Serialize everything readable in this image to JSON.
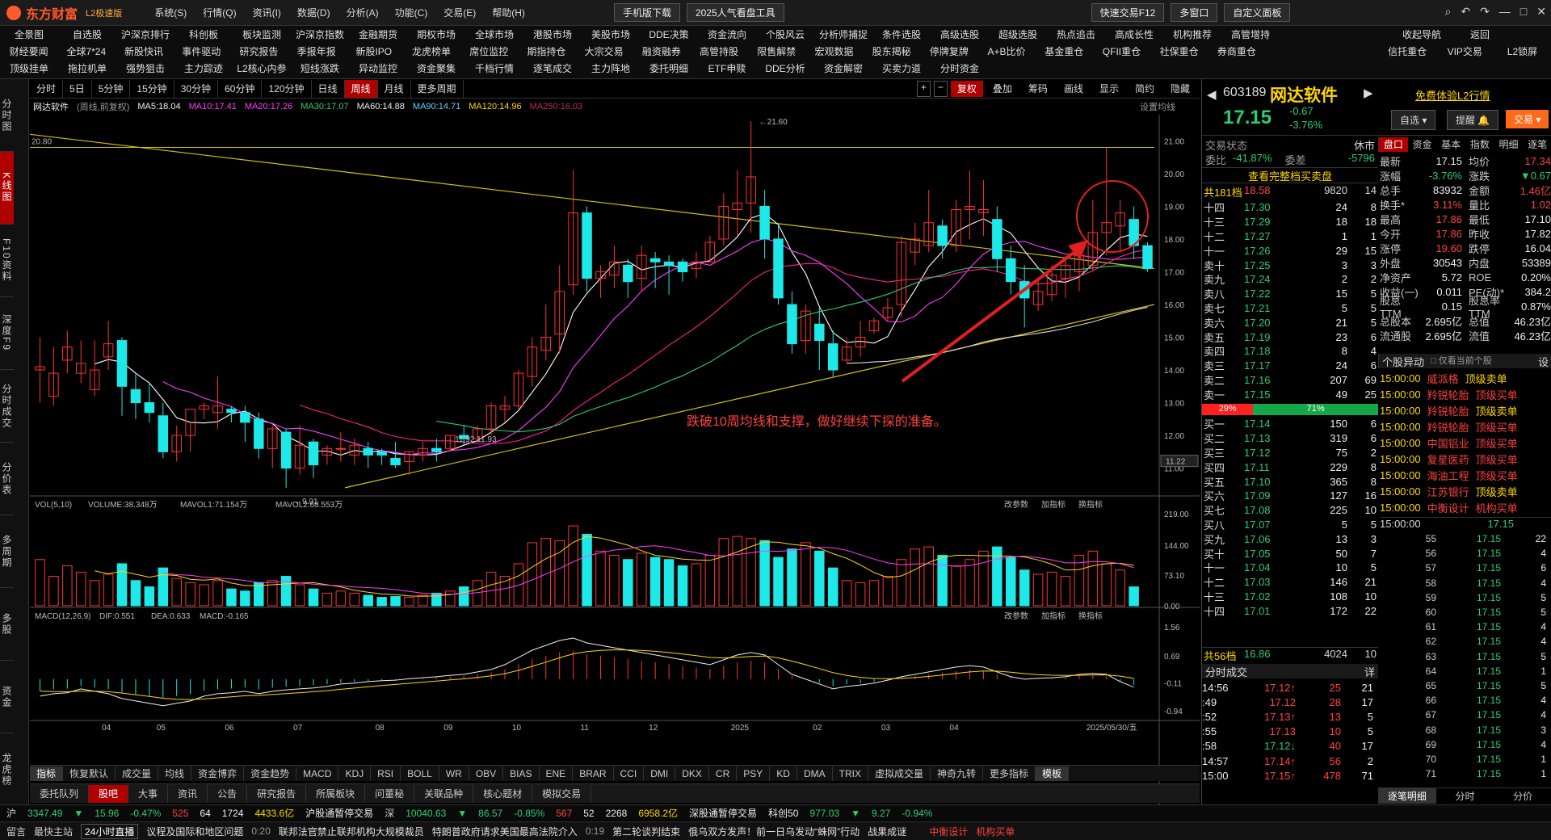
{
  "app": {
    "title": "东方财富",
    "edition": "L2极速版",
    "menus": [
      "系统(S)",
      "行情(Q)",
      "资讯(I)",
      "数据(D)",
      "分析(A)",
      "功能(C)",
      "交易(E)",
      "帮助(H)"
    ],
    "mobile_download": "手机版下载",
    "promo": "2025人气看盘工具",
    "quick_trade": "快速交易F12",
    "multi_window": "多窗口",
    "custom_panel": "自定义面板"
  },
  "nav": {
    "row1": [
      "全景图",
      "自选股",
      "沪深京排行",
      "科创板",
      "板块监测",
      "沪深京指数",
      "金融期货",
      "期权市场",
      "全球市场",
      "港股市场",
      "美股市场",
      "DDE决策",
      "资金流向",
      "个股风云",
      "分析师捕捉",
      "条件选股",
      "高级选股",
      "超级选股",
      "热点追击",
      "高成长性",
      "机构推荐",
      "高管增持",
      "收起导航",
      "返回"
    ],
    "row2": [
      "财经要闻",
      "全球7*24",
      "新股快讯",
      "事件驱动",
      "研究报告",
      "季报年报",
      "新股IPO",
      "龙虎榜单",
      "席位监控",
      "期指持仓",
      "大宗交易",
      "融资融券",
      "高管持股",
      "限售解禁",
      "宏观数据",
      "股东揭秘",
      "停牌复牌",
      "A+B比价",
      "基金重仓",
      "QFII重仓",
      "社保重仓",
      "券商重仓",
      "信托重仓",
      "VIP交易",
      "L2锁屏"
    ],
    "row3": [
      "顶级挂单",
      "拖拉机单",
      "强势狙击",
      "主力踪迹",
      "L2核心内参",
      "短线涨跌",
      "异动监控",
      "资金聚集",
      "千档行情",
      "逐笔成交",
      "主力阵地",
      "委托明细",
      "ETF申赎",
      "DDE分析",
      "资金解密",
      "买卖力道",
      "分时资金"
    ]
  },
  "leftbar": [
    "分时图",
    "K线图",
    "F10资料",
    "深度F9",
    "分时成交",
    "分价表",
    "多周期",
    "多股",
    "资金",
    "龙虎榜"
  ],
  "periods": [
    "分时",
    "5日",
    "5分钟",
    "15分钟",
    "30分钟",
    "60分钟",
    "120分钟",
    "日线",
    "周线",
    "月线",
    "更多周期"
  ],
  "chart_toolbar": [
    "复权",
    "叠加",
    "筹码",
    "画线",
    "显示",
    "简约",
    "隐藏"
  ],
  "ma_line": {
    "name": "网达软件",
    "mode": "(周线,前复权)",
    "ma5": "MA5:18.04",
    "ma10": "MA10:17.41",
    "ma20": "MA20:17.26",
    "ma30": "MA30:17.07",
    "ma60": "MA60:14.88",
    "ma90": "MA90:14.71",
    "ma120": "MA120:14.96",
    "ma250": "MA250:16.03",
    "settings": "设置均线"
  },
  "annotation": "跌破10周均线和支撑，做好继续下探的准备。",
  "price_labels": {
    "high": "21.60",
    "low": "9.91",
    "level": "20.80",
    "current": "11.22",
    "mid": "11.92 11.93"
  },
  "vol_line": {
    "label": "VOL(5,10)",
    "volume": "VOLUME:38.348万",
    "mavol1": "MAVOL1:71.154万",
    "mavol2": "MAVOL2:68.553万"
  },
  "macd_line": {
    "label": "MACD(12,26,9)",
    "dif": "DIF:0.551",
    "dea": "DEA:0.633",
    "macd": "MACD:-0.165"
  },
  "panel_tools": [
    "改参数",
    "加指标",
    "换指标"
  ],
  "x_dates": [
    "04",
    "05",
    "06",
    "07",
    "08",
    "09",
    "10",
    "11",
    "12",
    "2025",
    "02",
    "03",
    "04",
    "2025/05/30/五"
  ],
  "indicator_tabs": [
    "指标",
    "恢复默认",
    "成交量",
    "均线",
    "资金博弈",
    "资金趋势",
    "MACD",
    "KDJ",
    "RSI",
    "BOLL",
    "WR",
    "OBV",
    "BIAS",
    "ENE",
    "BRAR",
    "CCI",
    "DMI",
    "DKX",
    "CR",
    "PSY",
    "KD",
    "DMA",
    "TRIX",
    "虚拟成交量",
    "神奇九转",
    "更多指标",
    "模板"
  ],
  "info_tabs": [
    "委托队列",
    "股吧",
    "大事",
    "资讯",
    "公告",
    "研究报告",
    "所属板块",
    "问董秘",
    "关联品种",
    "核心题材",
    "模拟交易"
  ],
  "chart_data": {
    "type": "candlestick",
    "title": "网达软件 周线",
    "y_ticks": [
      21.0,
      20.0,
      19.0,
      18.0,
      17.0,
      16.0,
      15.0,
      14.0,
      13.0,
      12.0,
      11.0
    ],
    "vol_ticks": [
      "219.00",
      "144.00",
      "73.10",
      "0.00"
    ],
    "macd_ticks": [
      "1.56",
      "0.69",
      "-0.11",
      "-0.94"
    ],
    "ylim": [
      10.2,
      21.8
    ],
    "candles": [
      [
        14.0,
        15.0,
        14.1,
        13.0
      ],
      [
        13.2,
        14.7,
        13.9,
        12.9
      ],
      [
        14.3,
        15.2,
        14.7,
        13.9
      ],
      [
        13.9,
        14.9,
        14.2,
        13.6
      ],
      [
        13.4,
        14.9,
        14.0,
        13.2
      ],
      [
        14.4,
        15.5,
        14.8,
        14.0
      ],
      [
        14.9,
        15.0,
        13.5,
        12.6
      ],
      [
        13.4,
        13.9,
        13.0,
        12.5
      ],
      [
        13.0,
        13.6,
        12.7,
        12.4
      ],
      [
        12.6,
        13.0,
        11.5,
        11.3
      ],
      [
        11.5,
        12.3,
        12.0,
        11.2
      ],
      [
        12.0,
        12.4,
        12.8,
        11.5
      ],
      [
        12.8,
        13.0,
        12.9,
        12.5
      ],
      [
        12.7,
        13.8,
        12.9,
        12.2
      ],
      [
        12.8,
        12.9,
        12.7,
        12.4
      ],
      [
        12.7,
        12.9,
        12.4,
        11.8
      ],
      [
        12.5,
        12.7,
        11.6,
        11.3
      ],
      [
        11.6,
        12.3,
        12.2,
        11.0
      ],
      [
        12.1,
        12.2,
        11.0,
        10.4
      ],
      [
        11.0,
        12.3,
        11.7,
        10.8
      ],
      [
        11.8,
        11.9,
        11.1,
        10.7
      ],
      [
        11.4,
        11.7,
        11.6,
        11.1
      ],
      [
        11.6,
        12.1,
        11.6,
        11.2
      ],
      [
        11.4,
        11.9,
        11.7,
        11.1
      ],
      [
        11.6,
        11.8,
        11.4,
        11.0
      ],
      [
        11.5,
        11.6,
        11.4,
        11.1
      ],
      [
        11.3,
        11.8,
        11.1,
        11.0
      ],
      [
        11.2,
        11.5,
        11.5,
        10.8
      ],
      [
        11.4,
        11.8,
        11.6,
        11.2
      ],
      [
        11.6,
        11.9,
        11.5,
        11.2
      ],
      [
        11.6,
        12.0,
        12.0,
        11.5
      ],
      [
        12.0,
        12.3,
        11.9,
        11.7
      ],
      [
        11.9,
        12.3,
        12.2,
        11.8
      ],
      [
        12.2,
        13.0,
        12.9,
        12.0
      ],
      [
        12.8,
        13.2,
        12.9,
        12.4
      ],
      [
        12.9,
        14.0,
        13.9,
        12.8
      ],
      [
        13.8,
        15.0,
        14.7,
        13.5
      ],
      [
        14.6,
        16.0,
        15.0,
        14.3
      ],
      [
        15.1,
        17.2,
        16.4,
        14.5
      ],
      [
        16.6,
        20.1,
        18.8,
        16.3
      ],
      [
        18.8,
        19.0,
        16.8,
        16.4
      ],
      [
        16.8,
        17.2,
        17.0,
        16.2
      ],
      [
        16.9,
        17.8,
        17.3,
        16.5
      ],
      [
        17.2,
        17.4,
        16.7,
        16.2
      ],
      [
        16.8,
        17.8,
        17.5,
        16.4
      ],
      [
        17.4,
        17.6,
        17.3,
        16.5
      ],
      [
        17.3,
        17.5,
        17.2,
        16.3
      ],
      [
        17.3,
        17.4,
        17.0,
        16.7
      ],
      [
        17.1,
        17.6,
        17.3,
        16.8
      ],
      [
        17.3,
        18.1,
        17.9,
        17.3
      ],
      [
        18.0,
        19.4,
        19.0,
        17.8
      ],
      [
        18.9,
        20.1,
        19.1,
        18.1
      ],
      [
        19.1,
        21.6,
        19.9,
        18.2
      ],
      [
        19.0,
        19.5,
        18.0,
        17.4
      ],
      [
        18.0,
        18.4,
        16.2,
        16.0
      ],
      [
        16.0,
        16.4,
        14.8,
        14.5
      ],
      [
        14.9,
        16.0,
        15.8,
        14.5
      ],
      [
        15.4,
        15.9,
        14.9,
        14.0
      ],
      [
        14.8,
        15.2,
        14.0,
        13.8
      ],
      [
        14.3,
        15.0,
        14.7,
        14.2
      ],
      [
        14.7,
        15.5,
        15.0,
        14.4
      ],
      [
        15.2,
        15.6,
        15.5,
        15.1
      ],
      [
        15.6,
        16.2,
        15.9,
        15.5
      ],
      [
        16.0,
        18.1,
        17.9,
        15.6
      ],
      [
        17.6,
        18.5,
        18.0,
        17.2
      ],
      [
        17.8,
        19.5,
        18.5,
        17.6
      ],
      [
        18.4,
        18.6,
        17.8,
        17.4
      ],
      [
        17.8,
        19.2,
        18.9,
        17.6
      ],
      [
        18.9,
        20.1,
        19.0,
        18.0
      ],
      [
        18.8,
        19.8,
        18.9,
        18.1
      ],
      [
        18.6,
        19.0,
        17.4,
        17.0
      ],
      [
        17.4,
        17.8,
        16.7,
        16.3
      ],
      [
        16.7,
        17.2,
        16.2,
        15.3
      ],
      [
        16.0,
        16.8,
        16.4,
        15.8
      ],
      [
        16.3,
        17.2,
        16.9,
        16.1
      ],
      [
        16.8,
        17.5,
        17.2,
        16.2
      ],
      [
        17.0,
        17.6,
        17.5,
        16.4
      ],
      [
        17.2,
        19.2,
        18.2,
        17.0
      ],
      [
        18.2,
        20.8,
        18.5,
        17.5
      ],
      [
        18.4,
        19.2,
        18.8,
        17.6
      ],
      [
        18.6,
        19.0,
        17.8,
        17.4
      ],
      [
        17.8,
        17.9,
        17.1,
        17.0
      ]
    ],
    "volumes": [
      110,
      70,
      95,
      80,
      60,
      75,
      100,
      60,
      45,
      90,
      65,
      55,
      50,
      60,
      40,
      35,
      55,
      60,
      70,
      50,
      40,
      30,
      35,
      30,
      25,
      20,
      22,
      20,
      25,
      30,
      35,
      45,
      60,
      80,
      70,
      100,
      150,
      160,
      155,
      190,
      170,
      130,
      120,
      110,
      125,
      115,
      110,
      95,
      100,
      120,
      160,
      165,
      160,
      155,
      115,
      135,
      150,
      130,
      90,
      60,
      55,
      60,
      70,
      110,
      135,
      140,
      120,
      95,
      110,
      130,
      140,
      115,
      85,
      75,
      80,
      70,
      120,
      130,
      100,
      85,
      45
    ],
    "macd": [
      -0.35,
      -0.3,
      -0.28,
      -0.2,
      -0.25,
      -0.3,
      -0.4,
      -0.45,
      -0.5,
      -0.55,
      -0.5,
      -0.45,
      -0.35,
      -0.3,
      -0.28,
      -0.25,
      -0.3,
      -0.25,
      -0.22,
      -0.2,
      -0.18,
      -0.15,
      -0.1,
      -0.08,
      -0.05,
      -0.03,
      -0.02,
      0.01,
      0.03,
      0.05,
      0.08,
      0.1,
      0.15,
      0.2,
      0.3,
      0.45,
      0.6,
      0.7,
      0.8,
      0.85,
      0.75,
      0.7,
      0.65,
      0.6,
      0.55,
      0.5,
      0.45,
      0.4,
      0.35,
      0.3,
      0.4,
      0.5,
      0.55,
      0.5,
      0.3,
      0.1,
      0.0,
      -0.1,
      -0.2,
      -0.15,
      -0.12,
      -0.08,
      -0.02,
      0.05,
      0.1,
      0.15,
      0.2,
      0.25,
      0.28,
      0.25,
      0.15,
      0.05,
      0.0,
      0.02,
      0.03,
      0.05,
      0.1,
      0.12,
      0.1,
      -0.05,
      -0.165
    ]
  },
  "stock": {
    "code": "603189",
    "name": "网达软件",
    "price": "17.15",
    "change": "-0.67",
    "pct": "-3.76%",
    "btn_watch": "自选",
    "btn_remind": "提醒",
    "btn_trade": "交易",
    "promo": "免费体验L2行情"
  },
  "status": {
    "label": "交易状态",
    "value": "休市"
  },
  "order_ratio": {
    "wb": "委比",
    "wb_v": "-41.87%",
    "wc": "委差",
    "wc_v": "-5796"
  },
  "full_book": "查看完整档买卖盘",
  "ask_top": {
    "label": "共181档",
    "price": "18.58",
    "vol": "9820",
    "n": "14"
  },
  "asks": [
    [
      "十四",
      "17.30",
      "24",
      "8"
    ],
    [
      "十三",
      "17.29",
      "18",
      "18"
    ],
    [
      "十二",
      "17.27",
      "1",
      "1"
    ],
    [
      "十一",
      "17.26",
      "29",
      "15"
    ],
    [
      "卖十",
      "17.25",
      "3",
      "3"
    ],
    [
      "卖九",
      "17.24",
      "2",
      "2"
    ],
    [
      "卖八",
      "17.22",
      "15",
      "5"
    ],
    [
      "卖七",
      "17.21",
      "5",
      "5"
    ],
    [
      "卖六",
      "17.20",
      "21",
      "5"
    ],
    [
      "卖五",
      "17.19",
      "23",
      "6"
    ],
    [
      "卖四",
      "17.18",
      "8",
      "4"
    ],
    [
      "卖三",
      "17.17",
      "24",
      "6"
    ],
    [
      "卖二",
      "17.16",
      "207",
      "69"
    ],
    [
      "卖一",
      "17.15",
      "49",
      "25"
    ]
  ],
  "split": {
    "left": "29%",
    "right": "71%"
  },
  "bids": [
    [
      "买一",
      "17.14",
      "150",
      "6"
    ],
    [
      "买二",
      "17.13",
      "319",
      "6"
    ],
    [
      "买三",
      "17.12",
      "75",
      "2"
    ],
    [
      "买四",
      "17.11",
      "229",
      "8"
    ],
    [
      "买五",
      "17.10",
      "365",
      "8"
    ],
    [
      "买六",
      "17.09",
      "127",
      "16"
    ],
    [
      "买七",
      "17.08",
      "225",
      "10"
    ],
    [
      "买八",
      "17.07",
      "5",
      "5"
    ],
    [
      "买九",
      "17.06",
      "13",
      "3"
    ],
    [
      "买十",
      "17.05",
      "50",
      "7"
    ],
    [
      "十一",
      "17.04",
      "10",
      "5"
    ],
    [
      "十二",
      "17.03",
      "146",
      "21"
    ],
    [
      "十三",
      "17.02",
      "108",
      "10"
    ],
    [
      "十四",
      "17.01",
      "172",
      "22"
    ]
  ],
  "bid_bottom": {
    "label": "共56档",
    "price": "16.86",
    "vol": "4024",
    "n": "10"
  },
  "detail_tabs": [
    "盘口",
    "资金",
    "基本",
    "指数",
    "明细",
    "逐笔"
  ],
  "stats": [
    [
      "最新",
      "17.15",
      "均价",
      "17.34"
    ],
    [
      "涨幅",
      "-3.76%",
      "涨跌",
      "▼0.67"
    ],
    [
      "总手",
      "83932",
      "金额",
      "1.46亿"
    ],
    [
      "换手*",
      "3.11%",
      "量比",
      "1.02"
    ],
    [
      "最高",
      "17.86",
      "最低",
      "17.10"
    ],
    [
      "今开",
      "17.86",
      "昨收",
      "17.82"
    ],
    [
      "涨停",
      "19.60",
      "跌停",
      "16.04"
    ],
    [
      "外盘",
      "30543",
      "内盘",
      "53389"
    ],
    [
      "净资产",
      "5.72",
      "ROE",
      "0.20%"
    ],
    [
      "收益(一)",
      "0.011",
      "PE(动)*",
      "384.2"
    ],
    [
      "股息TTM",
      "0.15",
      "股息率TTM",
      "0.87%"
    ],
    [
      "总股本",
      "2.695亿",
      "总值",
      "46.23亿"
    ],
    [
      "流通股",
      "2.695亿",
      "流值",
      "46.23亿"
    ]
  ],
  "alerts_head": {
    "title": "个股异动",
    "opt": "仅看当前个股",
    "set": "设"
  },
  "alerts": [
    [
      "15:00:00",
      "威派格",
      "顶级卖单"
    ],
    [
      "15:00:00",
      "羚锐轮胎",
      "顶级买单"
    ],
    [
      "15:00:00",
      "羚锐轮胎",
      "顶级卖单"
    ],
    [
      "15:00:00",
      "羚锐轮胎",
      "顶级买单"
    ],
    [
      "15:00:00",
      "中国铝业",
      "顶级买单"
    ],
    [
      "15:00:00",
      "复星医药",
      "顶级买单"
    ],
    [
      "15:00:00",
      "海油工程",
      "顶级买单"
    ],
    [
      "15:00:00",
      "江苏银行",
      "顶级卖单"
    ],
    [
      "15:00:00",
      "中衡设计",
      "机构买单"
    ]
  ],
  "ticks_right_head": {
    "t": "15:00:00",
    "p": "17.15"
  },
  "ticks_right": [
    [
      "55",
      "17.15",
      "22"
    ],
    [
      "56",
      "17.15",
      "4"
    ],
    [
      "57",
      "17.15",
      "6"
    ],
    [
      "58",
      "17.15",
      "4"
    ],
    [
      "59",
      "17.15",
      "5"
    ],
    [
      "60",
      "17.15",
      "5"
    ],
    [
      "61",
      "17.15",
      "4"
    ],
    [
      "62",
      "17.15",
      "4"
    ],
    [
      "63",
      "17.15",
      "5"
    ],
    [
      "64",
      "17.15",
      "1"
    ],
    [
      "65",
      "17.15",
      "5"
    ],
    [
      "66",
      "17.15",
      "4"
    ],
    [
      "67",
      "17.15",
      "4"
    ],
    [
      "68",
      "17.15",
      "3"
    ],
    [
      "69",
      "17.15",
      "4"
    ],
    [
      "70",
      "17.15",
      "1"
    ],
    [
      "71",
      "17.15",
      "1"
    ]
  ],
  "trades_head": {
    "title": "分时成交",
    "btn": "详"
  },
  "trades": [
    [
      "14:56",
      "17.12↑",
      "25",
      "21"
    ],
    [
      ":49",
      "17.12",
      "28",
      "17"
    ],
    [
      ":52",
      "17.13↑",
      "13",
      "5"
    ],
    [
      ":55",
      "17.13",
      "10",
      "5"
    ],
    [
      ":58",
      "17.12↓",
      "40",
      "17"
    ],
    [
      "14:57",
      "17.14↑",
      "56",
      "2"
    ],
    [
      "15:00",
      "17.15↑",
      "478",
      "71"
    ]
  ],
  "right_bottom_tabs": [
    "逐笔明细",
    "分时",
    "分价"
  ],
  "indexbar": [
    "沪",
    "3347.49",
    "▼",
    "15.96",
    "-0.47%",
    "525",
    "64",
    "1724",
    "4433.6亿",
    "沪股通暂停交易",
    "深",
    "10040.63",
    "▼",
    "86.57",
    "-0.85%",
    "567",
    "52",
    "2268",
    "6958.2亿",
    "深股通暂停交易",
    "科创50",
    "977.03",
    "▼",
    "9.27",
    "-0.94%"
  ],
  "news": {
    "left": "留言",
    "warn": "最快主站",
    "live": "24小时直播",
    "items": [
      "议程及国际和地区问题",
      "0:20",
      "联邦法官禁止联邦机构大规模裁员",
      "特朗普政府请求美国最高法院介入",
      "0:19",
      "第二轮谈判结束",
      "俄乌双方发声！前一日乌发动“蛛网”行动",
      "战果成谜"
    ],
    "right": "中衡设计",
    "right2": "机构买单"
  }
}
